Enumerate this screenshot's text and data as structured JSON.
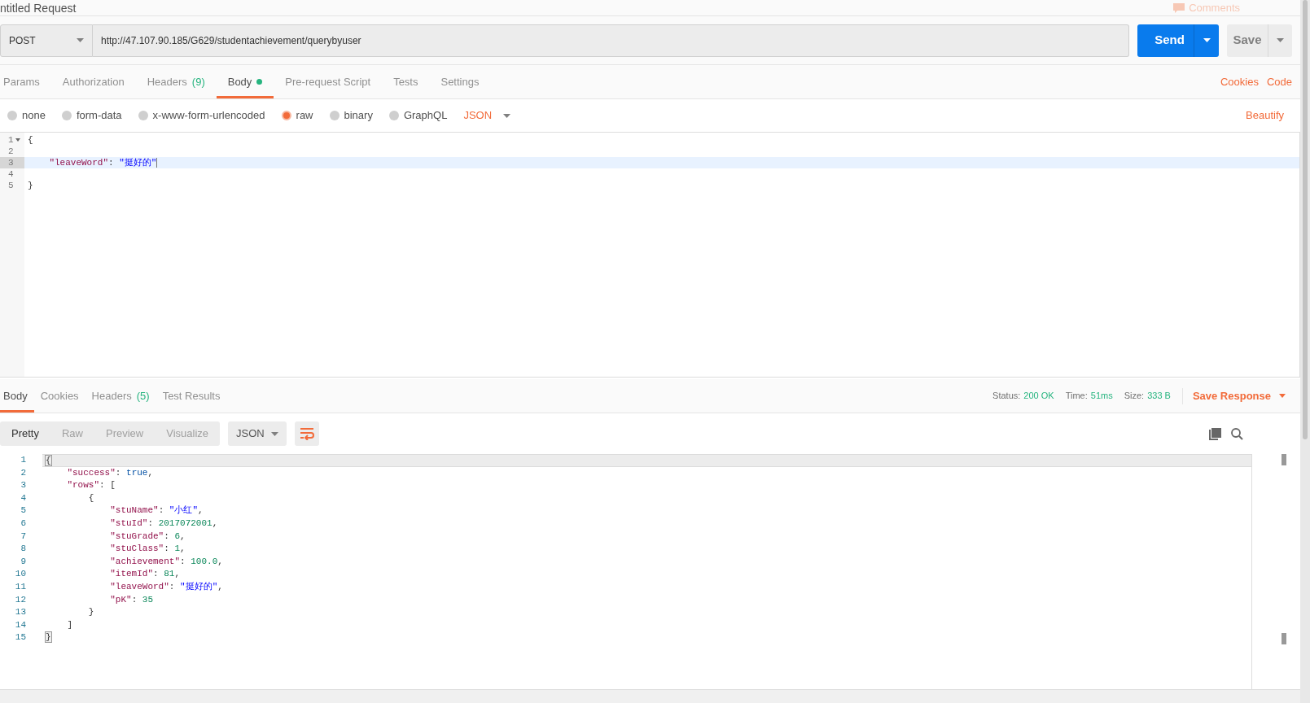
{
  "title": "ntitled Request",
  "comments": "Comments",
  "request": {
    "method": "POST",
    "url": "http://47.107.90.185/G629/studentachievement/querybyuser",
    "send": "Send",
    "save": "Save"
  },
  "request_tabs": [
    {
      "label": "Params",
      "selected": false
    },
    {
      "label": "Authorization",
      "selected": false
    },
    {
      "label": "Headers",
      "count": "(9)",
      "selected": false
    },
    {
      "label": "Body",
      "has_content": true,
      "selected": true
    },
    {
      "label": "Pre-request Script",
      "selected": false
    },
    {
      "label": "Tests",
      "selected": false
    },
    {
      "label": "Settings",
      "selected": false
    }
  ],
  "request_links": [
    "Cookies",
    "Code"
  ],
  "body_types": [
    {
      "label": "none",
      "selected": false
    },
    {
      "label": "form-data",
      "selected": false
    },
    {
      "label": "x-www-form-urlencoded",
      "selected": false
    },
    {
      "label": "raw",
      "selected": true
    },
    {
      "label": "binary",
      "selected": false
    },
    {
      "label": "GraphQL",
      "selected": false
    }
  ],
  "body_format": "JSON",
  "beautify": "Beautify",
  "request_body": {
    "lines": [
      {
        "number": "1",
        "foldable": true,
        "selected": false,
        "tokens": [
          {
            "kind": "punct",
            "text": "{"
          }
        ]
      },
      {
        "number": "2",
        "selected": false
      },
      {
        "number": "3",
        "selected": true,
        "tokens": [
          {
            "kind": "key",
            "text": "    \"leaveWord\""
          },
          {
            "kind": "punct",
            "text": ": "
          },
          {
            "kind": "string",
            "text": "\"挺好的\""
          }
        ]
      },
      {
        "number": "4",
        "selected": false
      },
      {
        "number": "5",
        "selected": false,
        "tokens": [
          {
            "kind": "punct",
            "text": "}"
          }
        ]
      }
    ]
  },
  "response_tabs": [
    {
      "label": "Body",
      "selected": true
    },
    {
      "label": "Cookies",
      "selected": false
    },
    {
      "label": "Headers",
      "count": "(5)",
      "selected": false
    },
    {
      "label": "Test Results",
      "selected": false
    }
  ],
  "response_meta": [
    {
      "label": "Status:",
      "value": "200 OK"
    },
    {
      "label": "Time:",
      "value": "51ms"
    },
    {
      "label": "Size:",
      "value": "333 B"
    }
  ],
  "save_response": "Save Response",
  "view_modes": [
    {
      "label": "Pretty",
      "selected": true
    },
    {
      "label": "Raw",
      "selected": false
    },
    {
      "label": "Preview",
      "selected": false
    },
    {
      "label": "Visualize",
      "selected": false
    }
  ],
  "response_format": "JSON",
  "response_body": {
    "lines": [
      {
        "number": "1",
        "selected": true,
        "tokens": [
          {
            "kind": "bracket",
            "text": "{"
          }
        ]
      },
      {
        "number": "2",
        "selected": false,
        "tokens": [
          {
            "kind": "key",
            "text": "    \"success\""
          },
          {
            "kind": "punct",
            "text": ": "
          },
          {
            "kind": "literal",
            "text": "true"
          },
          {
            "kind": "punct",
            "text": ","
          }
        ]
      },
      {
        "number": "3",
        "selected": false,
        "tokens": [
          {
            "kind": "key",
            "text": "    \"rows\""
          },
          {
            "kind": "punct",
            "text": ": ["
          }
        ]
      },
      {
        "number": "4",
        "selected": false,
        "tokens": [
          {
            "kind": "punct",
            "text": "        {"
          }
        ]
      },
      {
        "number": "5",
        "selected": false,
        "tokens": [
          {
            "kind": "key",
            "text": "            \"stuName\""
          },
          {
            "kind": "punct",
            "text": ": "
          },
          {
            "kind": "string",
            "text": "\"小红\""
          },
          {
            "kind": "punct",
            "text": ","
          }
        ]
      },
      {
        "number": "6",
        "selected": false,
        "tokens": [
          {
            "kind": "key",
            "text": "            \"stuId\""
          },
          {
            "kind": "punct",
            "text": ": "
          },
          {
            "kind": "number",
            "text": "2017072001"
          },
          {
            "kind": "punct",
            "text": ","
          }
        ]
      },
      {
        "number": "7",
        "selected": false,
        "tokens": [
          {
            "kind": "key",
            "text": "            \"stuGrade\""
          },
          {
            "kind": "punct",
            "text": ": "
          },
          {
            "kind": "number",
            "text": "6"
          },
          {
            "kind": "punct",
            "text": ","
          }
        ]
      },
      {
        "number": "8",
        "selected": false,
        "tokens": [
          {
            "kind": "key",
            "text": "            \"stuClass\""
          },
          {
            "kind": "punct",
            "text": ": "
          },
          {
            "kind": "number",
            "text": "1"
          },
          {
            "kind": "punct",
            "text": ","
          }
        ]
      },
      {
        "number": "9",
        "selected": false,
        "tokens": [
          {
            "kind": "key",
            "text": "            \"achievement\""
          },
          {
            "kind": "punct",
            "text": ": "
          },
          {
            "kind": "number",
            "text": "100.0"
          },
          {
            "kind": "punct",
            "text": ","
          }
        ]
      },
      {
        "number": "10",
        "selected": false,
        "tokens": [
          {
            "kind": "key",
            "text": "            \"itemId\""
          },
          {
            "kind": "punct",
            "text": ": "
          },
          {
            "kind": "number",
            "text": "81"
          },
          {
            "kind": "punct",
            "text": ","
          }
        ]
      },
      {
        "number": "11",
        "selected": false,
        "tokens": [
          {
            "kind": "key",
            "text": "            \"leaveWord\""
          },
          {
            "kind": "punct",
            "text": ": "
          },
          {
            "kind": "string",
            "text": "\"挺好的\""
          },
          {
            "kind": "punct",
            "text": ","
          }
        ]
      },
      {
        "number": "12",
        "selected": false,
        "tokens": [
          {
            "kind": "key",
            "text": "            \"pK\""
          },
          {
            "kind": "punct",
            "text": ": "
          },
          {
            "kind": "number",
            "text": "35"
          }
        ]
      },
      {
        "number": "13",
        "selected": false,
        "tokens": [
          {
            "kind": "punct",
            "text": "        }"
          }
        ]
      },
      {
        "number": "14",
        "selected": false,
        "tokens": [
          {
            "kind": "punct",
            "text": "    ]"
          }
        ]
      },
      {
        "number": "15",
        "selected": false,
        "tokens": [
          {
            "kind": "bracket",
            "text": "}"
          }
        ]
      }
    ]
  }
}
